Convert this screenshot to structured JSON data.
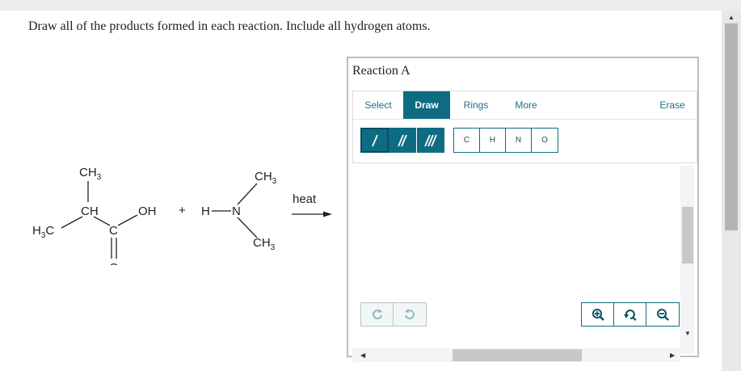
{
  "prompt": "Draw all of the products formed in each reaction. Include all hydrogen atoms.",
  "reaction": {
    "ch3_top": "CH",
    "ch3_top_sub": "3",
    "ch": "CH",
    "oh": "OH",
    "h3c": "H",
    "h3c_sub": "3",
    "h3c_c": "C",
    "carbonyl_c": "C",
    "carbonyl_o": "O",
    "plus": "+",
    "amine_h": "H",
    "amine_n": "N",
    "amine_ch3_top": "CH",
    "amine_ch3_bottom": "CH",
    "amine_sub": "3",
    "heat": "heat"
  },
  "panel": {
    "title": "Reaction A",
    "tabs": [
      "Select",
      "Draw",
      "Rings",
      "More",
      "Erase"
    ],
    "active_tab": "Draw",
    "bond_tools": [
      "single-bond",
      "double-bond",
      "triple-bond"
    ],
    "atoms": [
      "C",
      "H",
      "N",
      "O"
    ]
  },
  "colors": {
    "accent": "#0e6c82",
    "tab_text": "#1c6f8a"
  }
}
